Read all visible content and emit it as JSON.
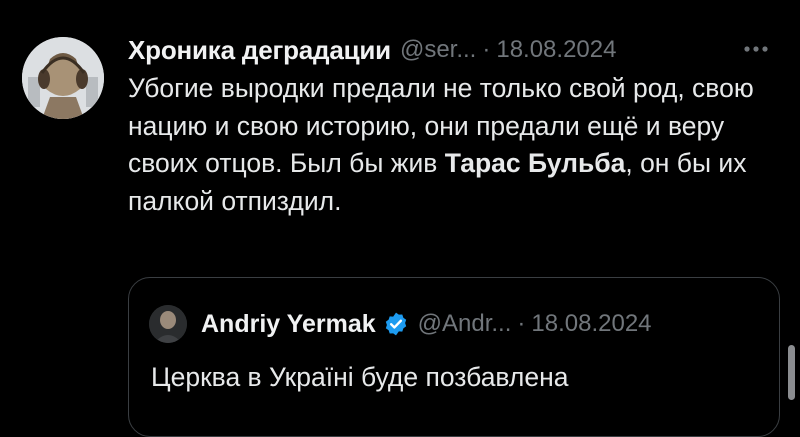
{
  "tweet": {
    "author_name": "Хроника деградации",
    "handle": "@ser...",
    "separator": "·",
    "date": "18.08.2024",
    "text_part1": "Убогие выродки предали не только свой род, свою нацию и свою историю, они предали ещё и веру своих отцов. Был бы жив ",
    "text_bold": "Тарас Бульба",
    "text_part2": ", он бы их палкой отпиздил."
  },
  "quote": {
    "author_name": "Andriy Yermak",
    "handle": "@Andr...",
    "separator": "·",
    "date": "18.08.2024",
    "text": "Церква в Україні буде позбавлена"
  },
  "colors": {
    "background": "#000000",
    "text": "#e7e9ea",
    "muted": "#71767b",
    "verified": "#1d9bf0",
    "border": "#3a3e42"
  },
  "icons": {
    "more": "more-horizontal-icon",
    "verified": "verified-badge-icon"
  }
}
